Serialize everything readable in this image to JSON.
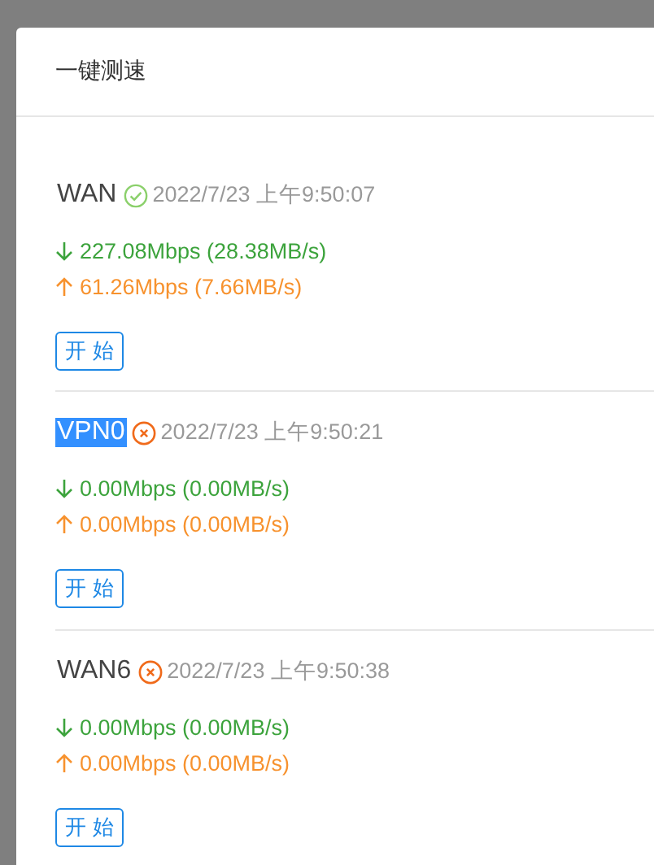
{
  "dialog": {
    "title": "一键测速"
  },
  "interfaces": [
    {
      "name": "WAN",
      "kind": "ok",
      "highlighted": false,
      "time": "2022/7/23 上午9:50:07",
      "download": "227.08Mbps (28.38MB/s)",
      "upload": "61.26Mbps (7.66MB/s)",
      "button": "开 始"
    },
    {
      "name": "VPN0",
      "kind": "fail",
      "highlighted": true,
      "time": "2022/7/23 上午9:50:21",
      "download": "0.00Mbps (0.00MB/s)",
      "upload": "0.00Mbps (0.00MB/s)",
      "button": "开 始"
    },
    {
      "name": "WAN6",
      "kind": "fail",
      "highlighted": false,
      "time": "2022/7/23 上午9:50:38",
      "download": "0.00Mbps (0.00MB/s)",
      "upload": "0.00Mbps (0.00MB/s)",
      "button": "开 始"
    }
  ]
}
